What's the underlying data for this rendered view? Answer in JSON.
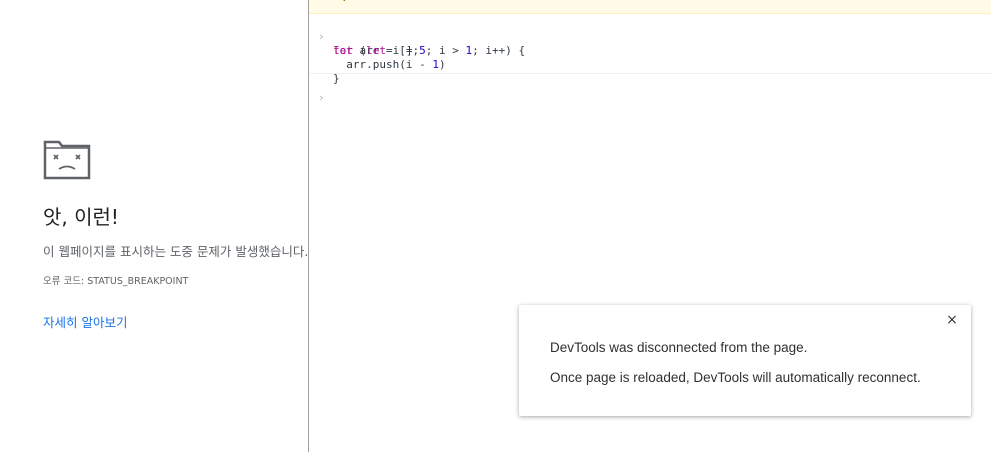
{
  "crash_page": {
    "icon": "sad-tab-icon",
    "title": "앗, 이런!",
    "message": "이 웹페이지를 표시하는 도중 문제가 발생했습니다.",
    "error_code": "오류 코드: STATUS_BREAKPOINT",
    "learn_more": "자세히 알아보기"
  },
  "console": {
    "prompt_glyph": "›",
    "truncated_output": "·",
    "code_lines": [
      "let arr = [];",
      "for (let i = 5; i > 1; i++) {",
      "  arr.push(i - 1)",
      "}"
    ]
  },
  "toast": {
    "close_glyph": "×",
    "line1": "DevTools was disconnected from the page.",
    "line2": "Once page is reloaded, DevTools will automatically reconnect."
  },
  "colors": {
    "link": "#1a73e8",
    "keyword": "#aa0d91",
    "number": "#1c00cf",
    "prompt": "#a6b2c6"
  }
}
